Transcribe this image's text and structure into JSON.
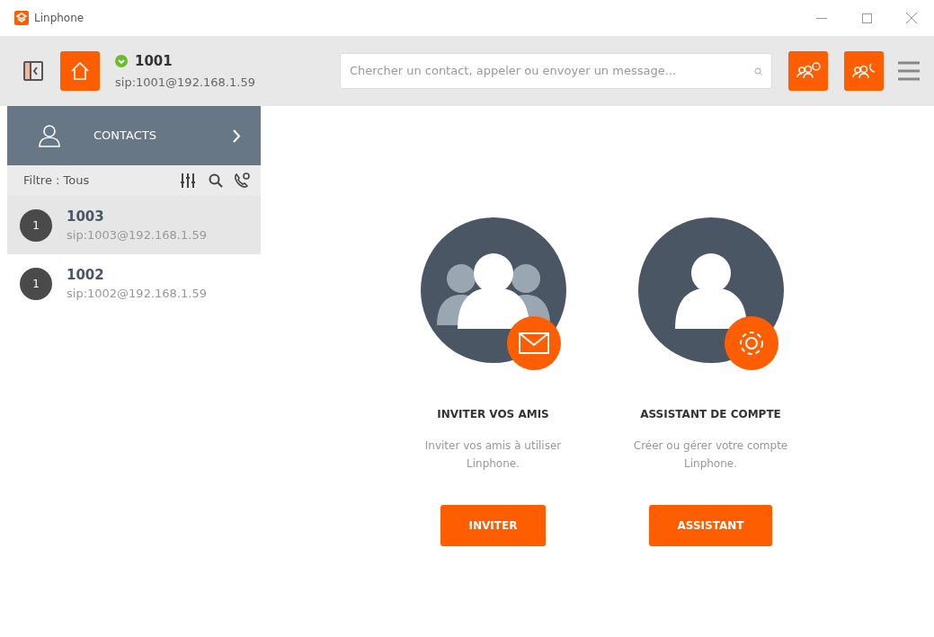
{
  "window": {
    "title": "Linphone"
  },
  "account": {
    "online": true,
    "name": "1001",
    "address": "sip:1001@192.168.1.59"
  },
  "search": {
    "placeholder": "Chercher un contact, appeler ou envoyer un message..."
  },
  "sidebar": {
    "header": "CONTACTS",
    "filter": "Filtre : Tous",
    "contacts": [
      {
        "initial": "1",
        "name": "1003",
        "address": "sip:1003@192.168.1.59",
        "selected": true
      },
      {
        "initial": "1",
        "name": "1002",
        "address": "sip:1002@192.168.1.59",
        "selected": false
      }
    ]
  },
  "cards": [
    {
      "kind": "invite",
      "title": "INVITER VOS AMIS",
      "description": "Inviter vos amis à utiliser Linphone.",
      "button": "INVITER"
    },
    {
      "kind": "assistant",
      "title": "ASSISTANT DE COMPTE",
      "description": "Créer ou gérer votre compte Linphone.",
      "button": "ASSISTANT"
    }
  ]
}
